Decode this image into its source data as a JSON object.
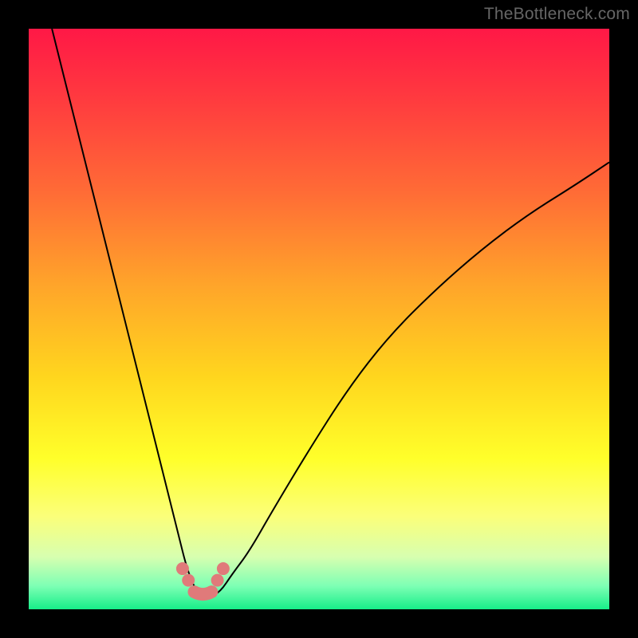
{
  "watermark": "TheBottleneck.com",
  "colors": {
    "background_frame": "#000000",
    "gradient_top": "#ff1846",
    "gradient_bottom": "#17ee89",
    "curve": "#000000",
    "marker": "#e07a7a"
  },
  "chart_data": {
    "type": "line",
    "title": "",
    "xlabel": "",
    "ylabel": "",
    "xlim": [
      0,
      100
    ],
    "ylim": [
      0,
      100
    ],
    "grid": false,
    "legend": false,
    "series": [
      {
        "name": "bottleneck-curve",
        "x": [
          4,
          6,
          8,
          10,
          12,
          14,
          16,
          18,
          20,
          22,
          24,
          26,
          27,
          28,
          29,
          30,
          31,
          33,
          35,
          38,
          42,
          48,
          55,
          62,
          70,
          78,
          86,
          94,
          100
        ],
        "y": [
          100,
          92,
          84,
          76,
          68,
          60,
          52,
          44,
          36,
          28,
          20,
          12,
          8,
          5,
          3,
          2,
          2,
          3,
          6,
          10,
          17,
          27,
          38,
          47,
          55,
          62,
          68,
          73,
          77
        ]
      }
    ],
    "markers": {
      "name": "bottom-highlight",
      "x": [
        26.5,
        27.5,
        28.5,
        29.5,
        30.5,
        31.5,
        32.5,
        33.5
      ],
      "y": [
        7,
        5,
        3,
        2,
        2,
        3,
        5,
        7
      ]
    },
    "annotations": []
  }
}
